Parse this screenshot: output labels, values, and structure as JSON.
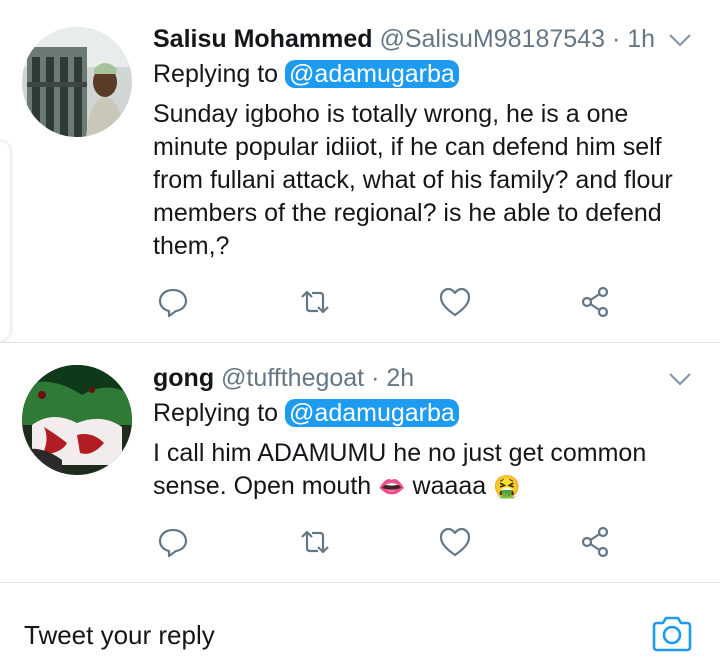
{
  "tweets": [
    {
      "display_name": "Salisu Mohammed",
      "handle": "@SalisuM98187543",
      "time": "· 1h",
      "replying_prefix": "Replying to",
      "replying_to": "@adamugarba",
      "body": "Sunday igboho is totally wrong, he is a one minute popular idiiot, if he can defend him self from fullani attack, what of his family? and flour members of the regional? is he able to defend them,?",
      "avatar_icon": "user-photo"
    },
    {
      "display_name": "gong",
      "handle": "@tuffthegoat",
      "time": "· 2h",
      "replying_prefix": "Replying to",
      "replying_to": "@adamugarba",
      "body_text": "I call him ADAMUMU he no just get common sense. Open mouth",
      "emoji_lips": "👄",
      "body_mid": " waaaa ",
      "emoji_sick": "🤮",
      "avatar_icon": "flag-photo"
    }
  ],
  "actions": [
    "reply-icon",
    "retweet-icon",
    "like-icon",
    "share-icon"
  ],
  "reply_bar": {
    "placeholder": "Tweet your reply"
  },
  "colors": {
    "accent": "#1d9bf0",
    "muted": "#657786",
    "divider": "#dde3e8"
  }
}
